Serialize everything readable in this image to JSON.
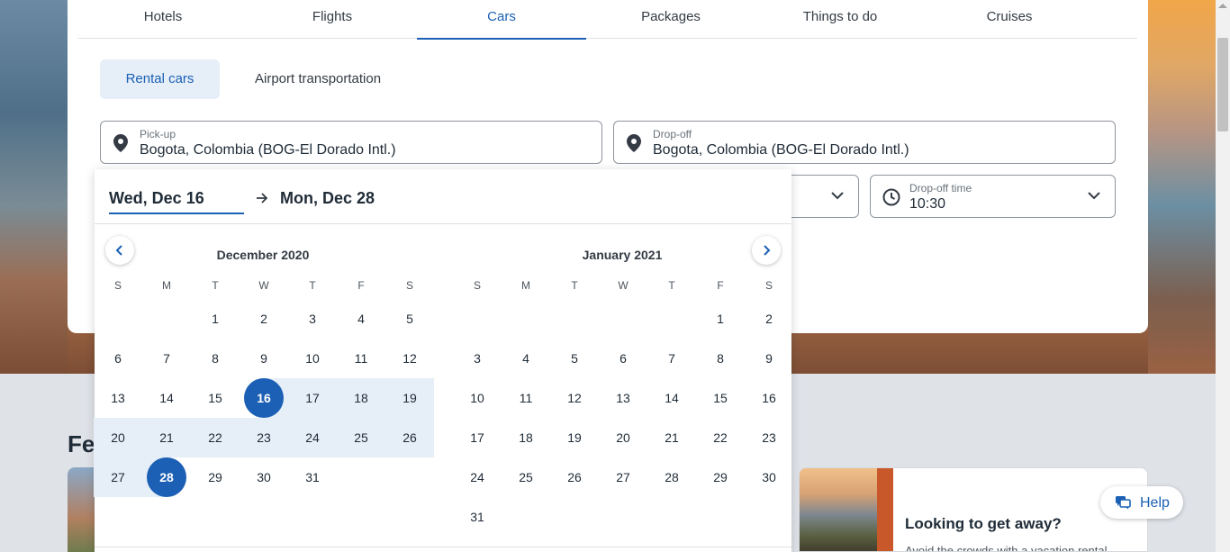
{
  "tabs": [
    "Hotels",
    "Flights",
    "Cars",
    "Packages",
    "Things to do",
    "Cruises"
  ],
  "active_tab": "Cars",
  "subtabs": {
    "rental": "Rental cars",
    "airport": "Airport transportation"
  },
  "pickup": {
    "label": "Pick-up",
    "value": "Bogota, Colombia (BOG-El Dorado Intl.)"
  },
  "dropoff": {
    "label": "Drop-off",
    "value": "Bogota, Colombia (BOG-El Dorado Intl.)"
  },
  "dropoff_time": {
    "label": "Drop-off time",
    "value": "10:30"
  },
  "datepicker": {
    "start": "Wed, Dec 16",
    "end": "Mon, Dec 28",
    "weekdays": [
      "S",
      "M",
      "T",
      "W",
      "T",
      "F",
      "S"
    ],
    "months": [
      {
        "title": "December 2020",
        "first_weekday": 2,
        "days": 31,
        "selected": [
          16,
          28
        ],
        "range": [
          16,
          28
        ]
      },
      {
        "title": "January 2021",
        "first_weekday": 5,
        "days": 31,
        "selected": [],
        "range": []
      }
    ]
  },
  "featured_heading": "Fe",
  "promo": {
    "title": "Looking to get away?",
    "text": "Avoid the crowds with a vacation rental"
  },
  "help_label": "Help",
  "colors": {
    "accent": "#1b60b4",
    "range": "#e6eef8"
  }
}
